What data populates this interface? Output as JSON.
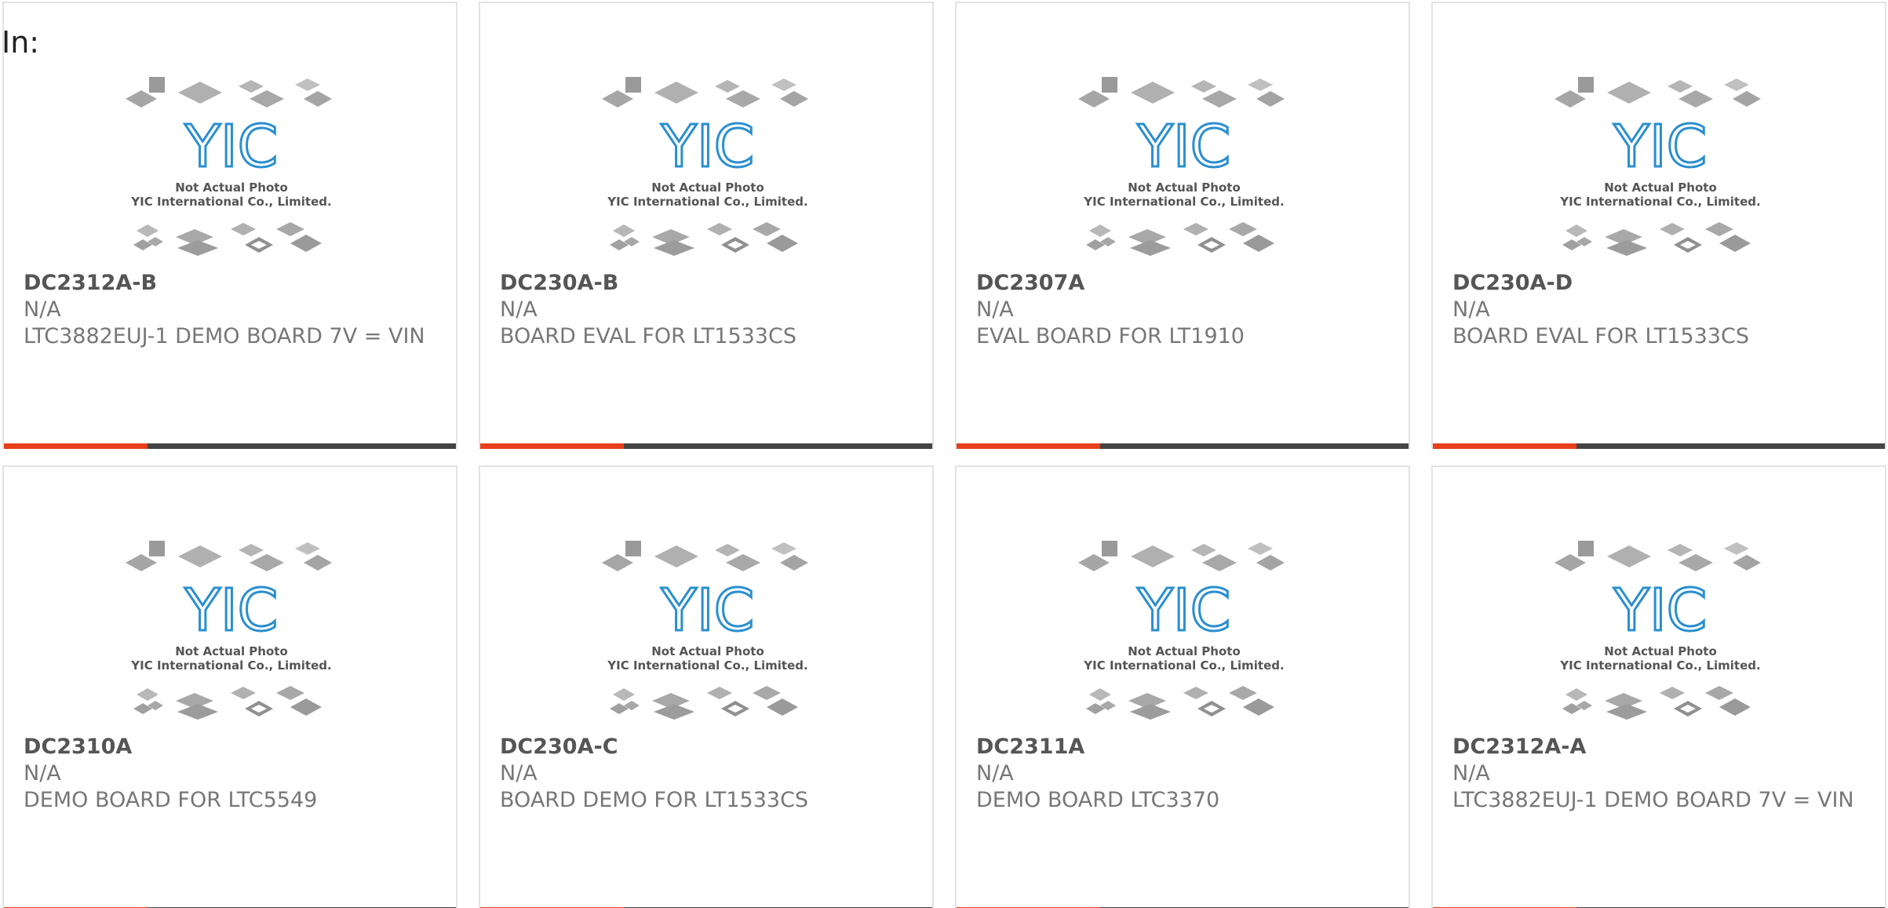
{
  "page": {
    "in_label": "In:"
  },
  "colors": {
    "accent": "#e8401b",
    "bar": "#444444",
    "card_border": "#e3e3e3",
    "text_muted": "#777777",
    "logo_blue": "#2a8fd0"
  },
  "placeholder": {
    "line1": "Not Actual Photo",
    "line2": "YIC International Co., Limited.",
    "logo_text": "YIC"
  },
  "products": [
    {
      "part": "DC2312A-B",
      "mfr": "N/A",
      "desc": "LTC3882EUJ-1 DEMO BOARD 7V = VIN"
    },
    {
      "part": "DC230A-B",
      "mfr": "N/A",
      "desc": "BOARD EVAL FOR LT1533CS"
    },
    {
      "part": "DC2307A",
      "mfr": "N/A",
      "desc": "EVAL BOARD FOR LT1910"
    },
    {
      "part": "DC230A-D",
      "mfr": "N/A",
      "desc": "BOARD EVAL FOR LT1533CS"
    },
    {
      "part": "DC2310A",
      "mfr": "N/A",
      "desc": "DEMO BOARD FOR LTC5549"
    },
    {
      "part": "DC230A-C",
      "mfr": "N/A",
      "desc": "BOARD DEMO FOR LT1533CS"
    },
    {
      "part": "DC2311A",
      "mfr": "N/A",
      "desc": "DEMO BOARD LTC3370"
    },
    {
      "part": "DC2312A-A",
      "mfr": "N/A",
      "desc": "LTC3882EUJ-1 DEMO BOARD 7V = VIN"
    }
  ]
}
